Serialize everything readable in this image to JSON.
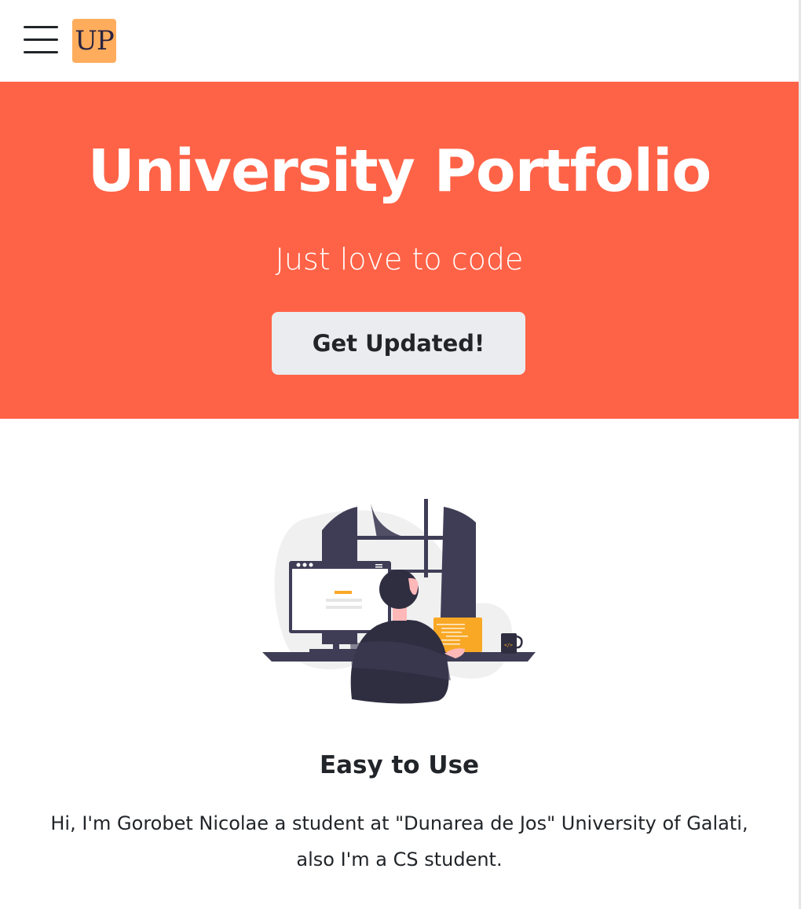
{
  "navbar": {
    "menu_icon": "hamburger-menu-icon",
    "brand_text": "UP",
    "brand_color": "#ffad5c"
  },
  "hero": {
    "title": "University Portfolio",
    "tagline": "Just love to code",
    "cta_label": "Get Updated!",
    "background_color": "#ff6347"
  },
  "feature": {
    "illustration_icon": "programmer-at-desk-illustration",
    "title": "Easy to Use",
    "text": "Hi, I'm Gorobet Nicolae a student at \"Dunarea de Jos\" University of Galati, also I'm a CS student."
  }
}
